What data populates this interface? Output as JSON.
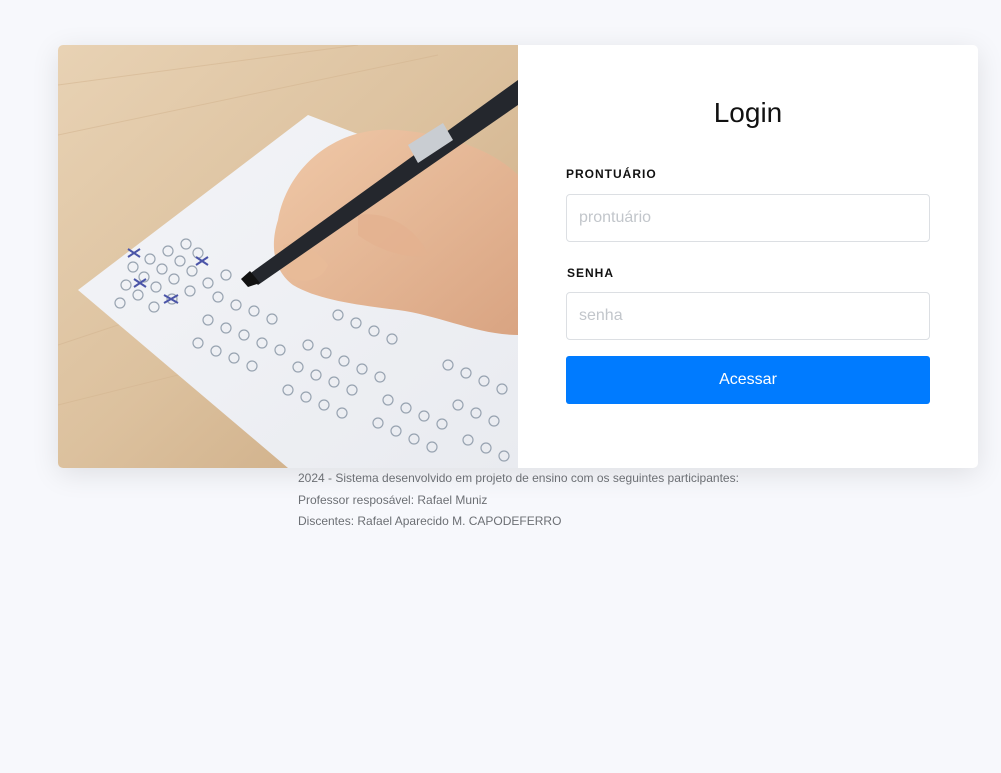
{
  "login": {
    "title": "Login",
    "prontuario_label": "PRONTUÁRIO",
    "prontuario_placeholder": "prontuário",
    "prontuario_value": "",
    "senha_label": "SENHA",
    "senha_placeholder": "senha",
    "senha_value": "",
    "submit_label": "Acessar"
  },
  "footer": {
    "line1": "2024 - Sistema desenvolvido em projeto de ensino com os seguintes participantes:",
    "line2": "Professor resposável: Rafael Muniz",
    "line3": "Discentes: Rafael Aparecido M. CAPODEFERRO"
  },
  "colors": {
    "page_background": "#f7f8fc",
    "button_primary": "#007bff"
  },
  "image": {
    "subject": "hand-writing-on-answer-sheet"
  }
}
